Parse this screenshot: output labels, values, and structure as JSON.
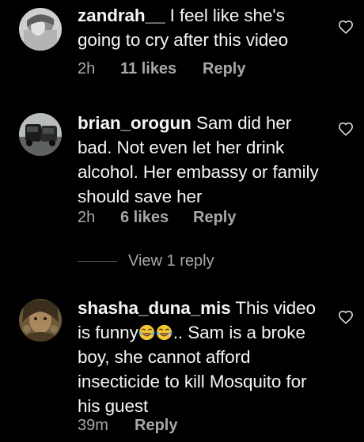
{
  "comments": [
    {
      "username": "zandrah__",
      "text": "I feel like she's going to cry after this video",
      "time": "2h",
      "likes": "11 likes",
      "reply": "Reply"
    },
    {
      "username": "brian_orogun",
      "text": "Sam did her bad. Not even let her drink alcohol. Her embassy or family should save her",
      "time": "2h",
      "likes": "6 likes",
      "reply": "Reply"
    },
    {
      "username": "shasha_duna_mis",
      "text_before": "This video is funny",
      "text_after": ".. Sam is a broke boy, she cannot afford insecticide to kill Mosquito for his guest",
      "emoji": "face-with-tears-of-joy x2",
      "time": "39m",
      "reply": "Reply"
    }
  ],
  "view_replies": "View 1 reply",
  "colors": {
    "background": "#000000",
    "text": "#f5f5f5",
    "secondary": "#a8a8a8"
  }
}
